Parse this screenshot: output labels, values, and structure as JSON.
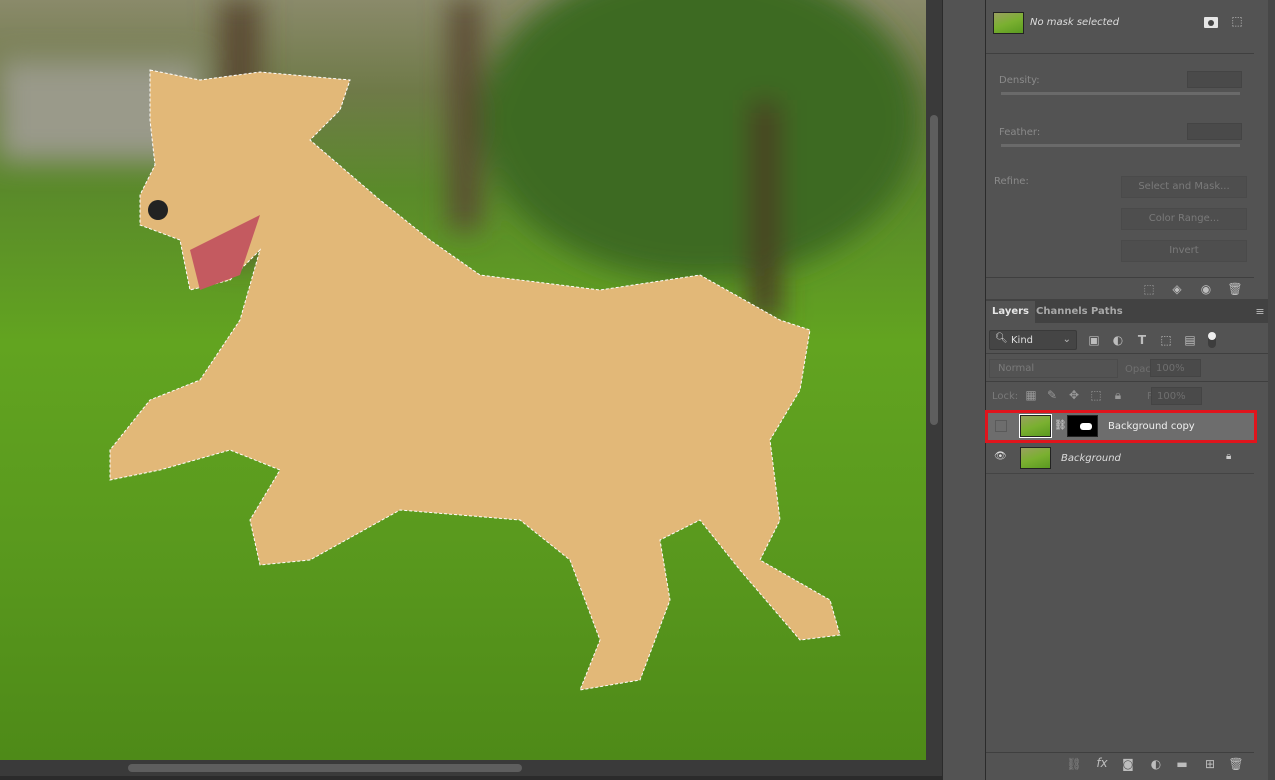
{
  "properties": {
    "mask_status": "No mask selected",
    "density_label": "Density:",
    "feather_label": "Feather:",
    "refine_label": "Refine:",
    "select_and_mask": "Select and Mask...",
    "color_range": "Color Range...",
    "invert": "Invert"
  },
  "layers_panel": {
    "tabs": [
      "Layers",
      "Channels",
      "Paths"
    ],
    "filter_kind": "Kind",
    "blend_mode": "Normal",
    "opacity_label": "Opacity:",
    "opacity_value": "100%",
    "lock_label": "Lock:",
    "fill_label": "Fill:",
    "fill_value": "100%",
    "layers": [
      {
        "name": "Background copy",
        "visible": false,
        "selected": true
      },
      {
        "name": "Background",
        "visible": true,
        "locked": true
      }
    ]
  },
  "colors": {
    "highlight": "#e0141c",
    "panel": "#535353"
  }
}
